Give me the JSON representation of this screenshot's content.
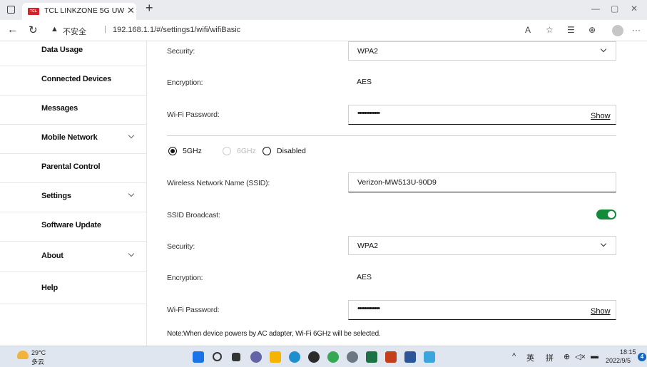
{
  "browser": {
    "tab_title": "TCL LINKZONE 5G UW",
    "favicon_text": "TCL",
    "security_label": "不安全",
    "url": "192.168.1.1/#/settings1/wifi/wifiBasic"
  },
  "sidebar": {
    "items": [
      {
        "label": "Data Usage",
        "has_chevron": false
      },
      {
        "label": "Connected Devices",
        "has_chevron": false
      },
      {
        "label": "Messages",
        "has_chevron": false
      },
      {
        "label": "Mobile Network",
        "has_chevron": true
      },
      {
        "label": "Parental Control",
        "has_chevron": false
      },
      {
        "label": "Settings",
        "has_chevron": true
      },
      {
        "label": "Software Update",
        "has_chevron": false
      },
      {
        "label": "About",
        "has_chevron": true
      },
      {
        "label": "Help",
        "has_chevron": false
      }
    ]
  },
  "wifi_top": {
    "security_label": "Security:",
    "security_value": "WPA2",
    "encryption_label": "Encryption:",
    "encryption_value": "AES",
    "password_label": "Wi-Fi Password:",
    "password_mask": "•••••••••••••",
    "show_label": "Show"
  },
  "band": {
    "options": [
      {
        "label": "5GHz",
        "checked": true,
        "disabled": false
      },
      {
        "label": "6GHz",
        "checked": false,
        "disabled": true
      },
      {
        "label": "Disabled",
        "checked": false,
        "disabled": false
      }
    ]
  },
  "wifi_5g": {
    "ssid_label": "Wireless Network Name (SSID):",
    "ssid_value": "Verizon-MW513U-90D9",
    "broadcast_label": "SSID Broadcast:",
    "broadcast_on": true,
    "security_label": "Security:",
    "security_value": "WPA2",
    "encryption_label": "Encryption:",
    "encryption_value": "AES",
    "password_label": "Wi-Fi Password:",
    "password_mask": "•••••••••••••",
    "show_label": "Show"
  },
  "note": "Note:When device powers by AC adapter, Wi-Fi 6GHz will be selected.",
  "taskbar": {
    "weather_temp": "29°C",
    "weather_condition": "多云",
    "tray_caret": "^",
    "tray_lang": "英",
    "tray_ime": "拼",
    "time": "18:15",
    "date": "2022/9/5",
    "notification_count": "4"
  },
  "colors": {
    "toggle_on": "#128a3a",
    "brand_red": "#d6202a"
  }
}
